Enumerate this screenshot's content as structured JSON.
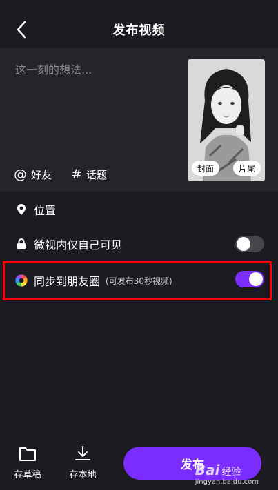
{
  "header": {
    "title": "发布视频"
  },
  "compose": {
    "placeholder": "这一刻的想法...",
    "thumb": {
      "cover_label": "封面",
      "end_label": "片尾"
    },
    "tags": [
      {
        "symbol": "@",
        "label": "好友"
      },
      {
        "symbol": "#",
        "label": "话题"
      }
    ]
  },
  "options": {
    "location_label": "位置",
    "private_label": "微视内仅自己可见",
    "private_toggle": "off",
    "sync_label": "同步到朋友圈",
    "sync_hint": "(可发布30秒视频)",
    "sync_toggle": "on"
  },
  "bottom": {
    "draft_label": "存草稿",
    "save_local_label": "存本地",
    "publish_label": "发布"
  },
  "watermark": {
    "brand": "Bai",
    "brand2": "经验",
    "url": "jingyan.baidu.com"
  },
  "colors": {
    "accent": "#7b2cff",
    "highlight": "#ff0000",
    "background": "#1c1b21"
  }
}
